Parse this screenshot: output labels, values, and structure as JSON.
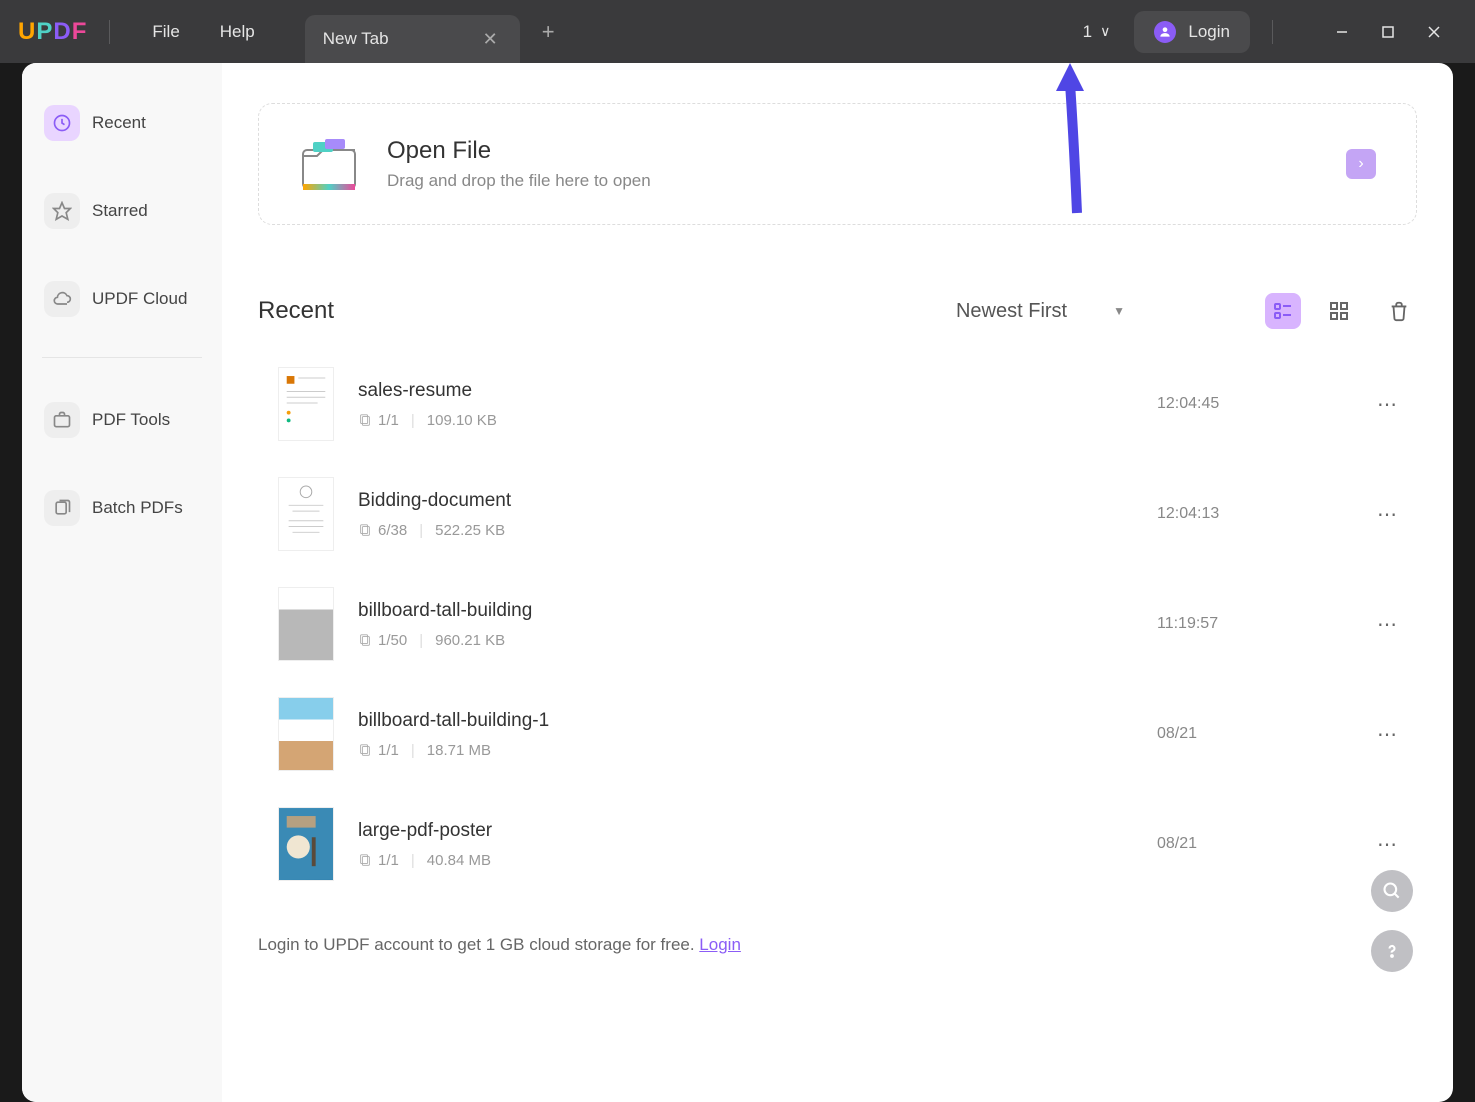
{
  "titlebar": {
    "menu": {
      "file": "File",
      "help": "Help"
    },
    "tab": {
      "title": "New Tab"
    },
    "counter": "1",
    "login": "Login"
  },
  "sidebar": {
    "items": [
      {
        "label": "Recent"
      },
      {
        "label": "Starred"
      },
      {
        "label": "UPDF Cloud"
      },
      {
        "label": "PDF Tools"
      },
      {
        "label": "Batch PDFs"
      }
    ]
  },
  "open_file": {
    "title": "Open File",
    "hint": "Drag and drop the file here to open"
  },
  "recent": {
    "title": "Recent",
    "sort": "Newest First",
    "files": [
      {
        "name": "sales-resume",
        "pages": "1/1",
        "size": "109.10 KB",
        "time": "12:04:45"
      },
      {
        "name": "Bidding-document",
        "pages": "6/38",
        "size": "522.25 KB",
        "time": "12:04:13"
      },
      {
        "name": "billboard-tall-building",
        "pages": "1/50",
        "size": "960.21 KB",
        "time": "11:19:57"
      },
      {
        "name": "billboard-tall-building-1",
        "pages": "1/1",
        "size": "18.71 MB",
        "time": "08/21"
      },
      {
        "name": "large-pdf-poster",
        "pages": "1/1",
        "size": "40.84 MB",
        "time": "08/21"
      }
    ]
  },
  "banner": {
    "text": "Login to UPDF account to get 1 GB cloud storage for free. ",
    "link": "Login"
  }
}
